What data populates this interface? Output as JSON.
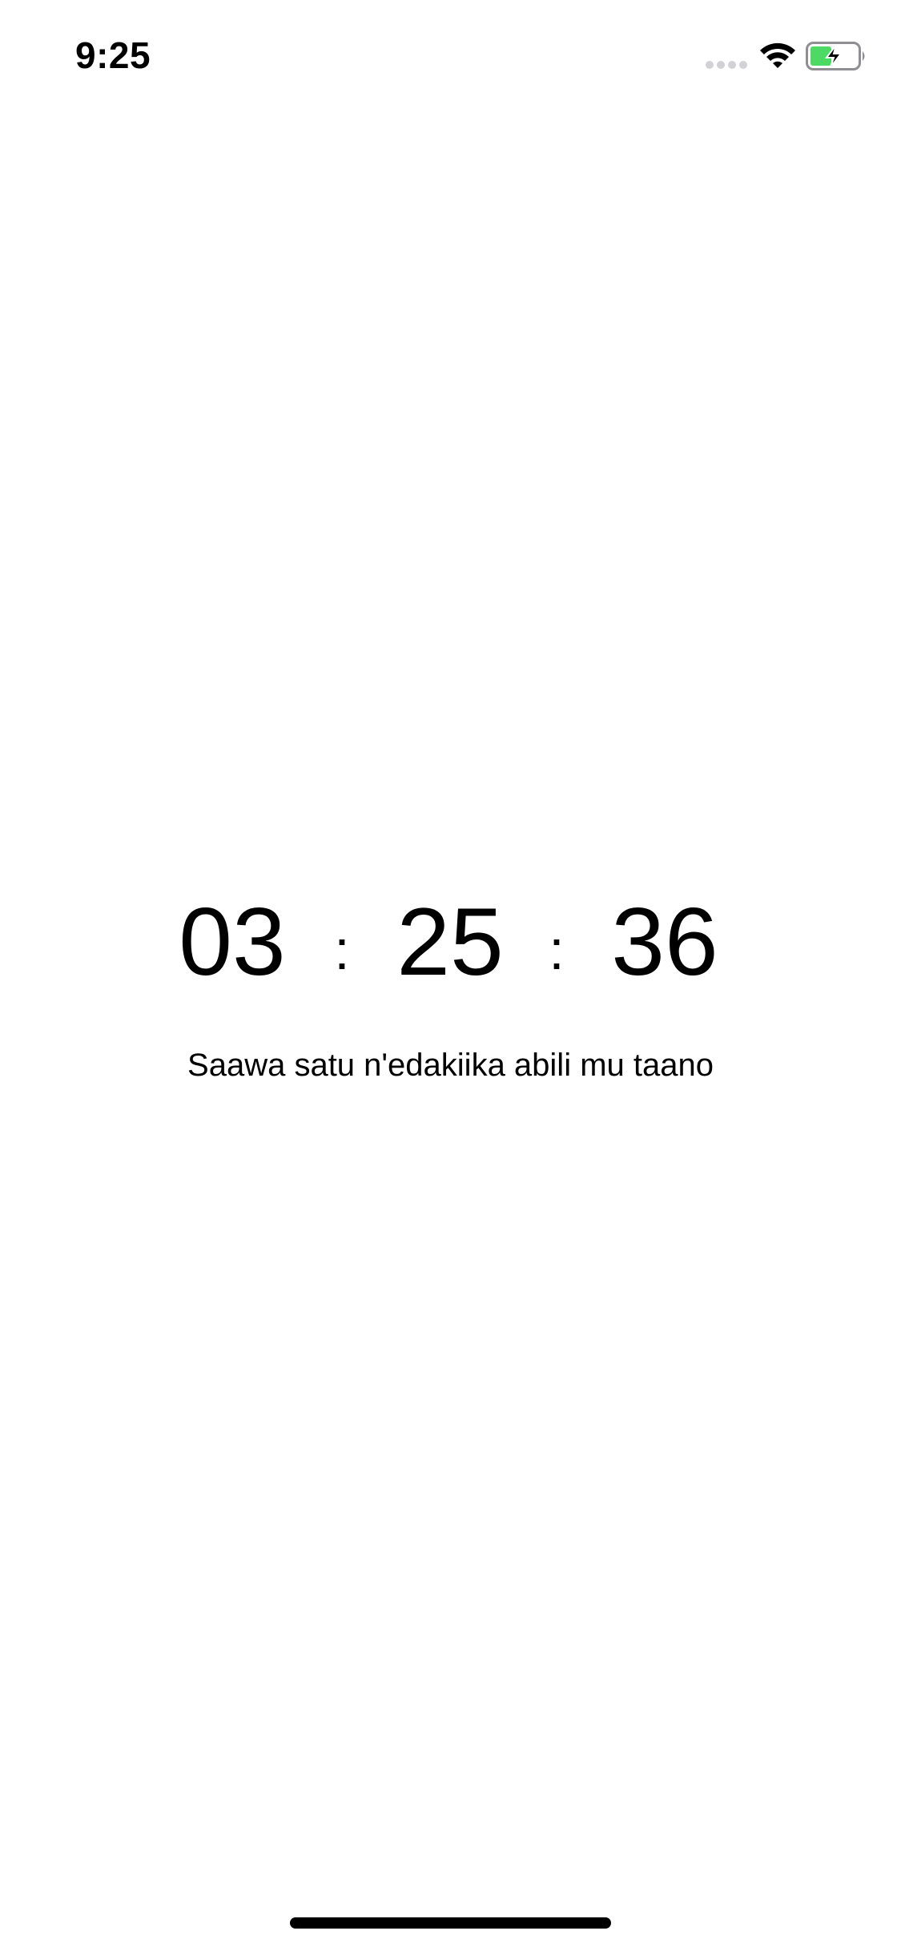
{
  "status_bar": {
    "time": "9:25",
    "signal_icon": "cellular-signal-icon",
    "wifi_icon": "wifi-icon",
    "battery_icon": "battery-charging-icon",
    "battery_fill_color": "#4cd964"
  },
  "clock": {
    "hours": "03",
    "minutes": "25",
    "seconds": "36",
    "separator": ":"
  },
  "time_in_words": "Saawa satu n'edakiika abili mu taano",
  "home_indicator_icon": "home-indicator"
}
